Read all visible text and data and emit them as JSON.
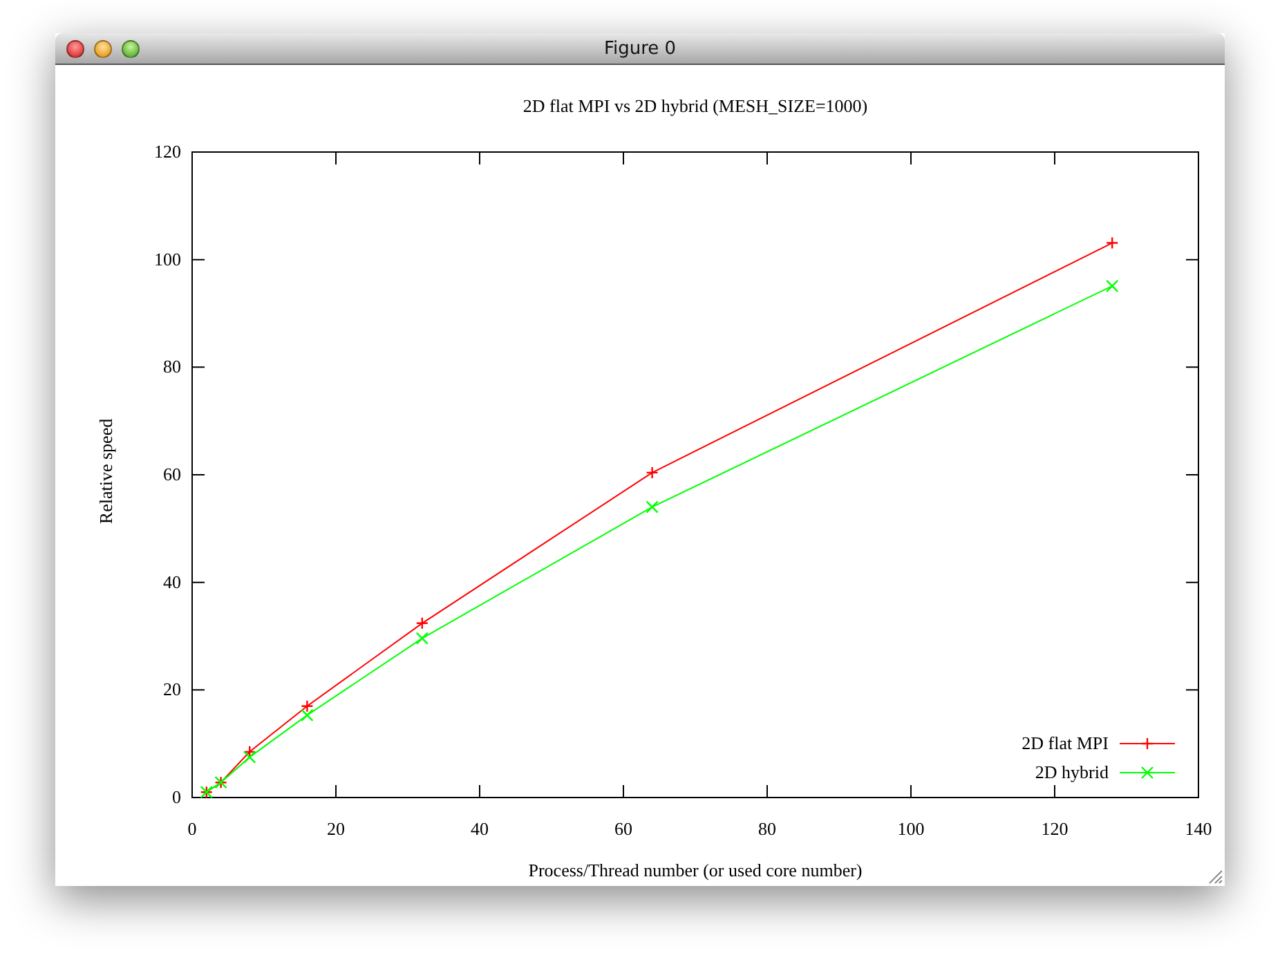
{
  "window": {
    "title": "Figure 0"
  },
  "chart_data": {
    "type": "line",
    "title": "2D flat MPI vs 2D hybrid (MESH_SIZE=1000)",
    "xlabel": "Process/Thread number (or used core number)",
    "ylabel": "Relative speed",
    "x": [
      2,
      4,
      8,
      16,
      32,
      64,
      128
    ],
    "xlim": [
      0,
      140
    ],
    "ylim": [
      0,
      120
    ],
    "legend": true,
    "xticks": [
      0,
      20,
      40,
      60,
      80,
      100,
      120,
      140
    ],
    "yticks": [
      0,
      20,
      40,
      60,
      80,
      100,
      120
    ],
    "series": [
      {
        "name": "2D flat MPI",
        "color": "#ff0000",
        "marker": "plus",
        "values": [
          1.0,
          2.8,
          8.5,
          17.0,
          32.4,
          60.4,
          103.1
        ]
      },
      {
        "name": "2D hybrid",
        "color": "#00ff00",
        "marker": "cross",
        "values": [
          1.0,
          2.8,
          7.5,
          15.3,
          29.6,
          54.0,
          95.1
        ]
      }
    ]
  }
}
